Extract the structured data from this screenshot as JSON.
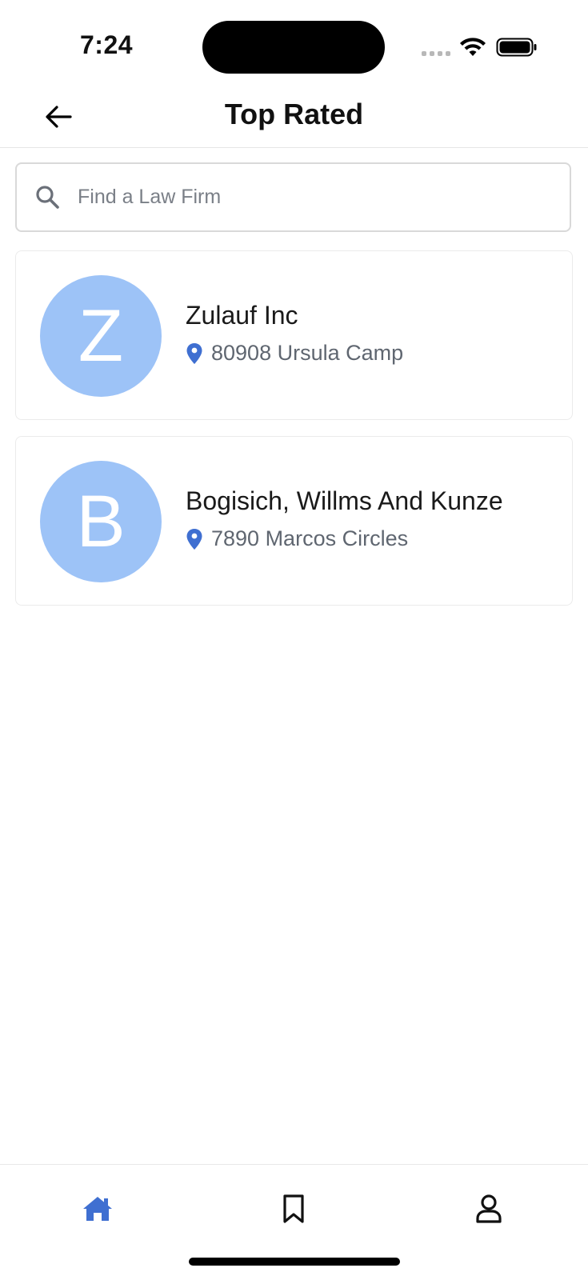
{
  "status_bar": {
    "time": "7:24"
  },
  "header": {
    "title": "Top Rated",
    "back_icon": "arrow-left-icon"
  },
  "search": {
    "placeholder": "Find a Law Firm",
    "value": "",
    "icon": "search-icon"
  },
  "firms": [
    {
      "initial": "Z",
      "name": "Zulauf Inc",
      "address": "80908 Ursula Camp"
    },
    {
      "initial": "B",
      "name": "Bogisich, Willms And Kunze",
      "address": "7890 Marcos Circles"
    }
  ],
  "bottom_nav": {
    "items": [
      {
        "icon": "home-icon",
        "active": true
      },
      {
        "icon": "bookmark-icon",
        "active": false
      },
      {
        "icon": "profile-icon",
        "active": false
      }
    ]
  },
  "colors": {
    "accent": "#3f6fd1",
    "avatar_bg": "#9dc3f7",
    "text_primary": "#1a1a1a",
    "text_secondary": "#5f6670"
  }
}
